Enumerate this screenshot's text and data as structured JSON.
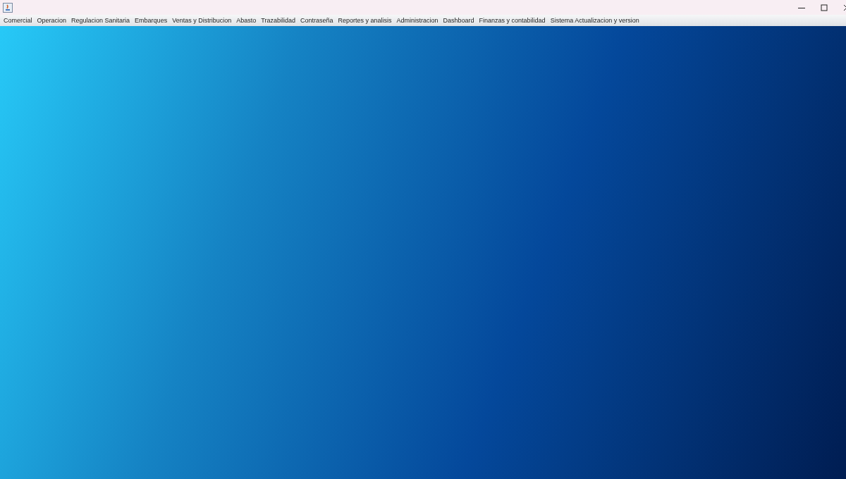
{
  "menu_bar": {
    "items": [
      {
        "label": "Comercial"
      },
      {
        "label": "Operacion"
      },
      {
        "label": "Regulacion Sanitaria"
      },
      {
        "label": "Embarques"
      },
      {
        "label": "Ventas y Distribucion"
      },
      {
        "label": "Abasto"
      },
      {
        "label": "Trazabilidad"
      },
      {
        "label": "Contraseña"
      },
      {
        "label": "Reportes y analisis"
      },
      {
        "label": "Administracion"
      },
      {
        "label": "Dashboard"
      },
      {
        "label": "Finanzas y contabilidad"
      },
      {
        "label": "Sistema Actualizacion y version"
      }
    ]
  }
}
